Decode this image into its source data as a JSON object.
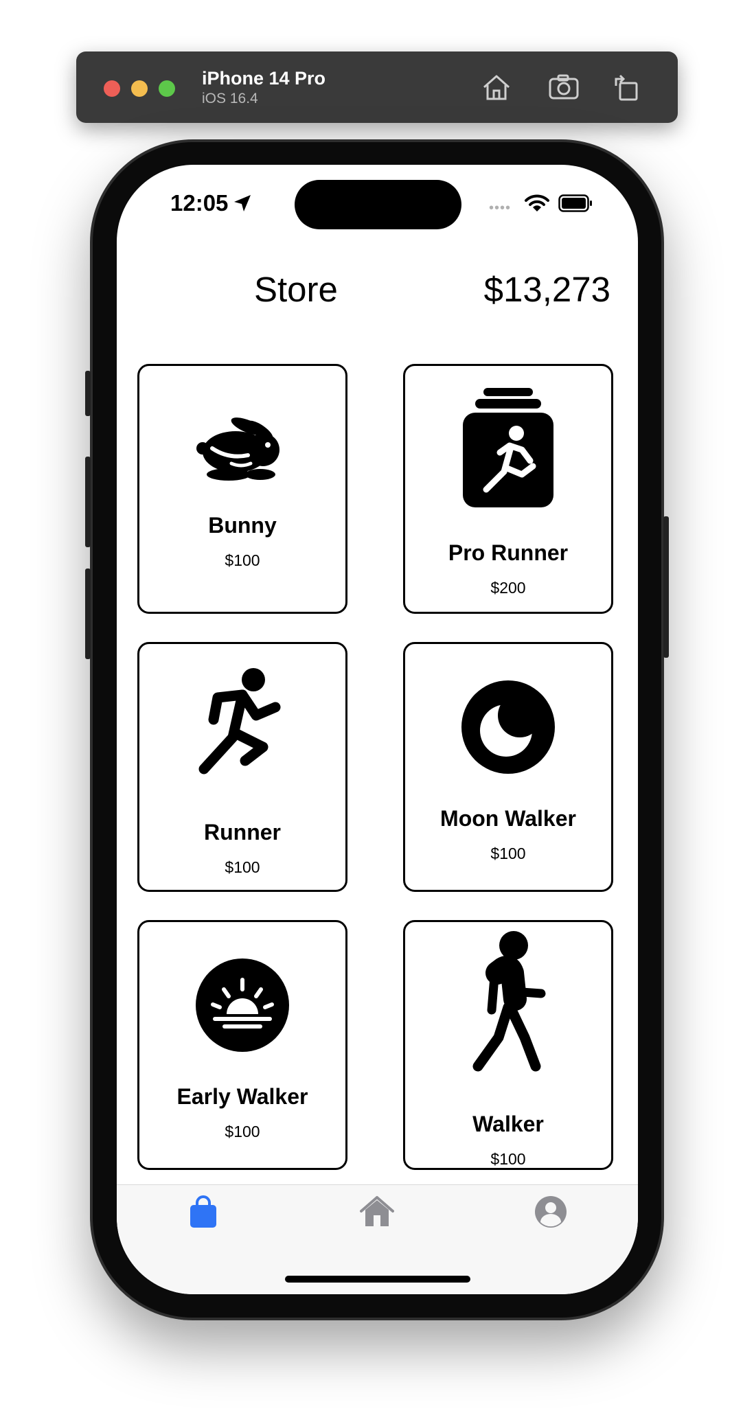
{
  "simulator": {
    "device": "iPhone 14 Pro",
    "os": "iOS 16.4",
    "buttons": [
      "home-icon",
      "screenshot-icon",
      "rotate-icon"
    ]
  },
  "status_bar": {
    "time": "12:05",
    "signal_dots": "••••"
  },
  "header": {
    "title": "Store",
    "balance": "$13,273"
  },
  "items": [
    {
      "name": "Bunny",
      "price": "$100",
      "icon": "rabbit-icon"
    },
    {
      "name": "Pro Runner",
      "price": "$200",
      "icon": "figure-run-square-stack-icon"
    },
    {
      "name": "Runner",
      "price": "$100",
      "icon": "figure-run-icon"
    },
    {
      "name": "Moon Walker",
      "price": "$100",
      "icon": "moon-circle-icon"
    },
    {
      "name": "Early Walker",
      "price": "$100",
      "icon": "sunrise-circle-icon"
    },
    {
      "name": "Walker",
      "price": "$100",
      "icon": "figure-walk-icon"
    }
  ],
  "tab_bar": {
    "tabs": [
      {
        "name": "store",
        "icon": "bag-icon",
        "selected": true
      },
      {
        "name": "home",
        "icon": "house-icon",
        "selected": false
      },
      {
        "name": "profile",
        "icon": "person-circle-icon",
        "selected": false
      }
    ],
    "active_color": "#2f74f5",
    "inactive_color": "#8e8e93"
  }
}
